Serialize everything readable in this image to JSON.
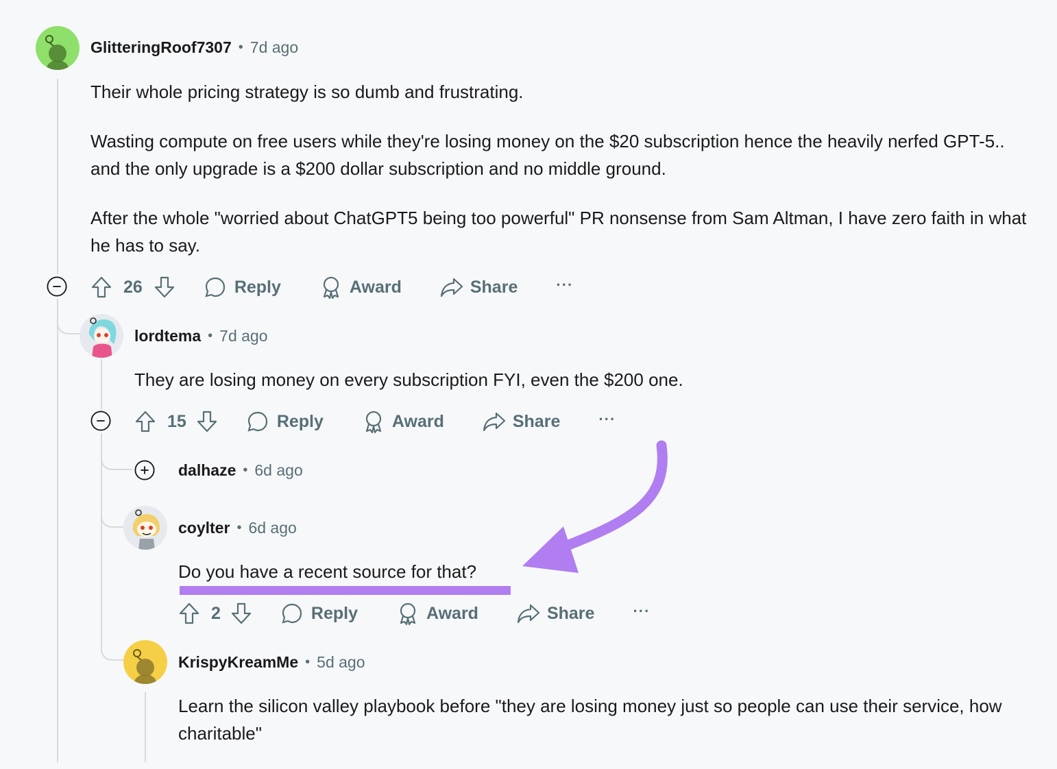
{
  "comments": [
    {
      "username": "GlitteringRoof7307",
      "time": "7d ago",
      "avatar_icon": "snoo-avatar-green",
      "paragraphs": [
        "Their whole pricing strategy is so dumb and frustrating.",
        "Wasting compute on free users while they're losing money on the $20 subscription hence the heavily nerfed GPT-5.. and the only upgrade is a $200 dollar subscription and no middle ground.",
        "After the whole \"worried about ChatGPT5 being too powerful\" PR nonsense from Sam Altman, I have zero faith in what he has to say."
      ],
      "votes": "26"
    },
    {
      "username": "lordtema",
      "time": "7d ago",
      "avatar_icon": "anime-avatar-cyan-hair",
      "paragraphs": [
        "They are losing money on every subscription FYI, even the $200 one."
      ],
      "votes": "15"
    },
    {
      "username": "dalhaze",
      "time": "6d ago",
      "collapsed": true
    },
    {
      "username": "coylter",
      "time": "6d ago",
      "avatar_icon": "tiger-avatar",
      "paragraphs": [
        "Do you have a recent source for that?"
      ],
      "votes": "2"
    },
    {
      "username": "KrispyKreamMe",
      "time": "5d ago",
      "avatar_icon": "snoo-avatar-yellow",
      "paragraphs": [
        "Learn the silicon valley playbook before \"they are losing money just so people can use their service, how charitable\""
      ]
    }
  ],
  "actions": {
    "reply": "Reply",
    "award": "Award",
    "share": "Share",
    "more": "···"
  },
  "separator": "•",
  "colors": {
    "annotation": "#b07ef0",
    "muted": "#576f76",
    "thread_line": "#d7dadc",
    "background": "#f7f8fa"
  }
}
